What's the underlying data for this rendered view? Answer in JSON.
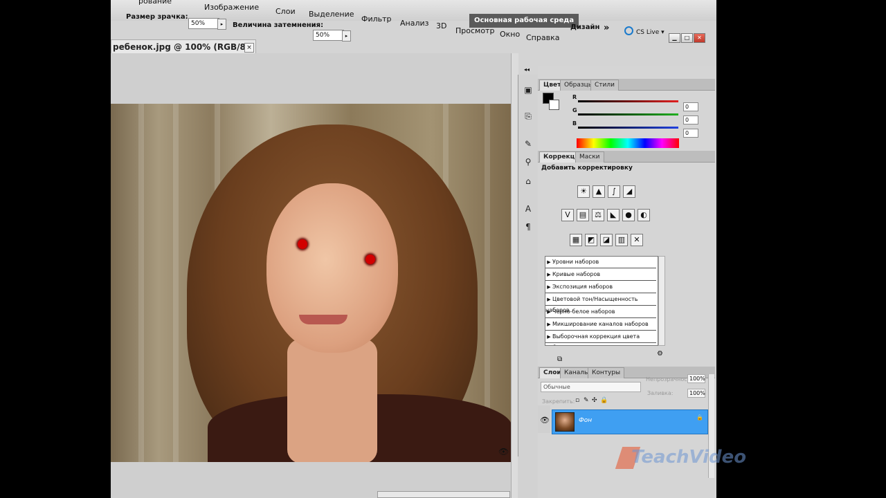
{
  "menu": {
    "items": [
      "рование",
      "Изображение",
      "Слои",
      "Выделение",
      "Фильтр",
      "Анализ",
      "3D",
      "Просмотр",
      "Окно",
      "Справка"
    ]
  },
  "options": {
    "pupil_label": "Размер зрачка:",
    "pupil_value": "50%",
    "darken_label": "Величина затемнения:",
    "darken_value": "50%"
  },
  "workspace": {
    "active": "Основная рабочая среда",
    "design": "Дизайн",
    "more": "»",
    "cslive": "CS Live ▾"
  },
  "document": {
    "tab_title": "ребенок.jpg @ 100% (RGB/8) *",
    "close": "×"
  },
  "color_panel": {
    "tabs": [
      "Цвет",
      "Образцы",
      "Стили"
    ],
    "channels": [
      {
        "name": "R",
        "value": "0",
        "color": "#e02020"
      },
      {
        "name": "G",
        "value": "0",
        "color": "#20b020"
      },
      {
        "name": "B",
        "value": "0",
        "color": "#2040e0"
      }
    ]
  },
  "adjustments_panel": {
    "tabs": [
      "Коррекция",
      "Маски"
    ],
    "heading": "Добавить корректировку",
    "icons_row1": [
      "☀",
      "▲",
      "∫",
      "◢"
    ],
    "icons_row2": [
      "V",
      "▤",
      "⚖",
      "◣",
      "●",
      "◐"
    ],
    "icons_row3": [
      "▦",
      "◩",
      "◪",
      "▥",
      "✕"
    ],
    "presets": [
      "Уровни наборов",
      "Кривые наборов",
      "Экспозиция наборов",
      "Цветовой тон/Насыщенность наборов",
      "Черно-белое наборов",
      "Микширование каналов наборов",
      "Выборочная коррекция цвета наборов"
    ]
  },
  "layers_panel": {
    "tabs": [
      "Слои",
      "Каналы",
      "Контуры"
    ],
    "blend_mode": "Обычные",
    "opacity_label": "Непрозрачность:",
    "opacity_value": "100%",
    "lock_label": "Закрепить:",
    "fill_label": "Заливка:",
    "fill_value": "100%",
    "layer_name": "Фон"
  },
  "watermark": {
    "text": "TeachVideo"
  }
}
